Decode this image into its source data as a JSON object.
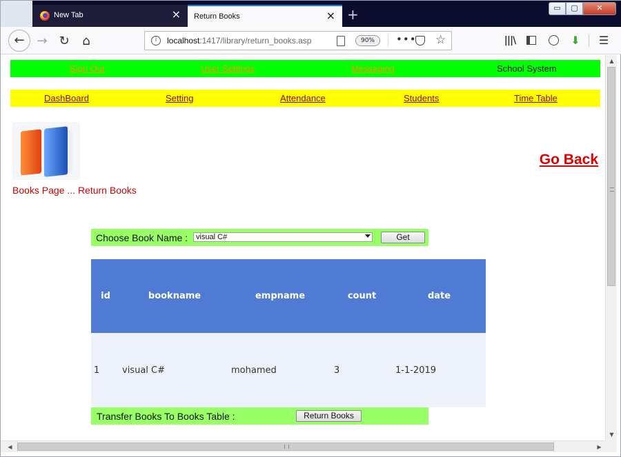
{
  "browser": {
    "tabs": [
      {
        "title": "New Tab",
        "active": false
      },
      {
        "title": "Return Books",
        "active": true
      }
    ],
    "url_host": "localhost",
    "url_rest": ":1417/library/return_books.asp",
    "zoom": "90%",
    "window_controls": {
      "minimize": "▭",
      "maximize": "▢",
      "close": "✕"
    },
    "icons": {
      "back": "arrow-left-icon",
      "forward": "arrow-right-icon",
      "reload": "reload-icon",
      "home": "home-icon",
      "library": "library-icon",
      "sidebar": "sidebar-icon",
      "account": "account-icon",
      "download": "download-icon",
      "menu": "hamburger-menu-icon"
    }
  },
  "top_nav": {
    "links": [
      "Sign Out",
      "User Settings",
      "Messaging"
    ],
    "brand": "School System"
  },
  "main_nav": {
    "links": [
      "DashBoard",
      "Setting",
      "Attendance",
      "Students",
      "Time Table"
    ]
  },
  "page": {
    "breadcrumb": "Books Page ... Return Books",
    "go_back": "Go Back"
  },
  "choose_form": {
    "label": "Choose Book Name :",
    "selected_book": "visual C#",
    "get_button": "Get"
  },
  "table": {
    "columns": [
      "id",
      "bookname",
      "empname",
      "count",
      "date"
    ],
    "rows": [
      [
        "1",
        "visual C#",
        "mohamed",
        "3",
        "1-1-2019"
      ]
    ]
  },
  "transfer_form": {
    "label": "Transfer Books To Books Table :",
    "return_button": "Return Books"
  },
  "colors": {
    "green_bar": "#00ff00",
    "yellow_bar": "#ffff00",
    "panel_green": "#99ff66",
    "table_header": "#4f7bd4",
    "link_red": "#e00000"
  }
}
